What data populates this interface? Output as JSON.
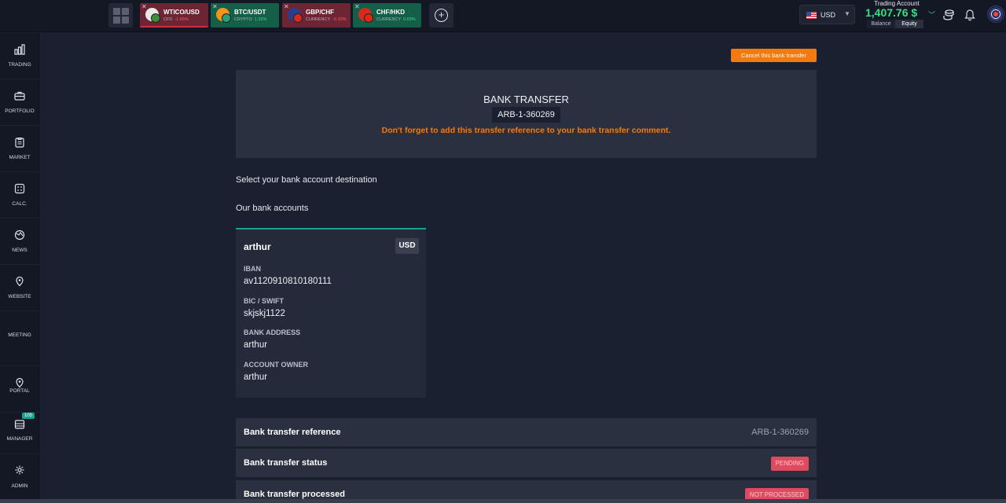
{
  "topbar": {
    "tabs": [
      {
        "symbol": "WTICO/USD",
        "category": "CFD",
        "change": "-1.65%",
        "direction": "neg",
        "bg": "#6e2533",
        "icon_colors": [
          "#e8e8e8",
          "#3a8f3a"
        ]
      },
      {
        "symbol": "BTC/USDT",
        "category": "CRYPTO",
        "change": "1.33%",
        "direction": "pos",
        "bg": "#155e48",
        "icon_colors": [
          "#f7931a",
          "#26a17b"
        ]
      },
      {
        "symbol": "GBP/CHF",
        "category": "CURRENCY",
        "change": "-0.33%",
        "direction": "neg",
        "bg": "#6e2533",
        "icon_colors": [
          "#2a3d8c",
          "#d52b1e"
        ]
      },
      {
        "symbol": "CHF/HKD",
        "category": "CURRENCY",
        "change": "0.69%",
        "direction": "pos",
        "bg": "#155e48",
        "icon_colors": [
          "#d52b1e",
          "#de2910"
        ]
      }
    ],
    "currency": "USD",
    "account_title": "Trading Account",
    "account_value": "1,407.76 $",
    "toggle_balance": "Balance",
    "toggle_equity": "Equity"
  },
  "sidebar": {
    "items": [
      {
        "label": "TRADING",
        "icon": "chart-bars-icon"
      },
      {
        "label": "PORTFOLIO",
        "icon": "briefcase-icon"
      },
      {
        "label": "MARKET",
        "icon": "clipboard-icon"
      },
      {
        "label": "CALC.",
        "icon": "calculator-icon"
      },
      {
        "label": "NEWS",
        "icon": "globe-icon"
      },
      {
        "label": "WEBSITE",
        "icon": "location-pin-icon"
      },
      {
        "label": "MEETING",
        "icon": "none"
      },
      {
        "label": "PORTAL",
        "icon": "location-pin-icon"
      },
      {
        "label": "MANAGER",
        "icon": "stack-icon",
        "badge": "105"
      },
      {
        "label": "ADMIN",
        "icon": "gear-icon"
      }
    ]
  },
  "main": {
    "cancel_button": "Cancel this bank transfer",
    "header_title": "BANK TRANSFER",
    "reference": "ARB-1-360269",
    "warning": "Don't forget to add this transfer reference to your bank transfer comment.",
    "select_destination": "Select your bank account destination",
    "our_bank_accounts": "Our bank accounts",
    "bank_card": {
      "name": "arthur",
      "currency": "USD",
      "fields": [
        {
          "label": "IBAN",
          "value": "av1120910810180111"
        },
        {
          "label": "BIC / SWIFT",
          "value": "skjskj1122"
        },
        {
          "label": "BANK ADDRESS",
          "value": "arthur"
        },
        {
          "label": "ACCOUNT OWNER",
          "value": "arthur"
        }
      ]
    },
    "info_rows": [
      {
        "label": "Bank transfer reference",
        "value": "ARB-1-360269"
      },
      {
        "label": "Bank transfer status",
        "badge": "PENDING"
      },
      {
        "label": "Bank transfer processed",
        "badge": "NOT PROCESSED"
      }
    ]
  },
  "colors": {
    "accent": "#f57a0d",
    "teal": "#1aa18f",
    "positive": "#3ddc84",
    "negative": "#ff5a6a"
  }
}
